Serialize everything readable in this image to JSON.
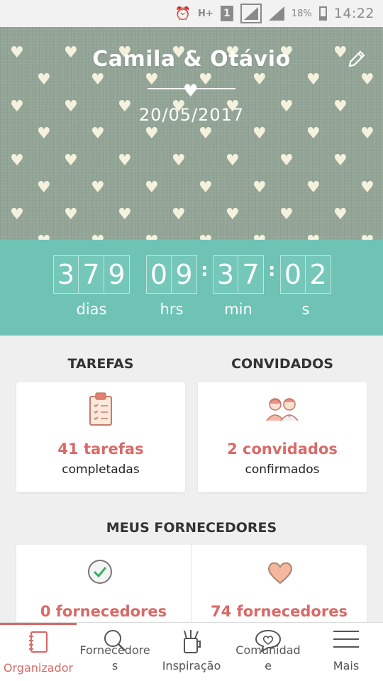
{
  "status_bar": {
    "battery_pct": "18%",
    "time": "14:22",
    "network": "H+",
    "sim": "1"
  },
  "hero": {
    "title": "Camila & Otávio",
    "date": "20/05/2017",
    "edit_icon": "pencil-icon"
  },
  "countdown": {
    "days": [
      "3",
      "7",
      "9"
    ],
    "hours": [
      "0",
      "9"
    ],
    "minutes": [
      "3",
      "7"
    ],
    "seconds": [
      "0",
      "2"
    ],
    "labels": {
      "days": "dias",
      "hours": "hrs",
      "minutes": "min",
      "seconds": "s"
    }
  },
  "tasks": {
    "title": "TAREFAS",
    "count": "41 tarefas",
    "sub": "completadas",
    "icon": "clipboard-icon"
  },
  "guests": {
    "title": "CONVIDADOS",
    "count": "2 convidados",
    "sub": "confirmados",
    "icon": "couple-icon"
  },
  "vendors": {
    "title": "MEUS FORNECEDORES",
    "left": {
      "count": "0 fornecedores",
      "icon": "checkmark-circle-icon"
    },
    "right": {
      "count": "74 fornecedores",
      "icon": "heart-icon"
    }
  },
  "nav": {
    "items": [
      {
        "label": "Organizador",
        "icon": "notebook-icon",
        "active": true
      },
      {
        "label": "Fornecedores",
        "icon": "search-icon",
        "active": false
      },
      {
        "label": "Inspiração",
        "icon": "pencil-cup-icon",
        "active": false
      },
      {
        "label": "Comunidade",
        "icon": "chat-heart-icon",
        "active": false
      },
      {
        "label": "Mais",
        "icon": "menu-icon",
        "active": false
      }
    ],
    "label_line1": {
      "fornecedores": "Fornecedore",
      "comunidade": "Comunidad"
    },
    "label_line2": {
      "fornecedores": "s",
      "comunidade": "e"
    }
  },
  "colors": {
    "accent": "#d86a67",
    "teal": "#6fc3b5",
    "hero_bg": "#93a597"
  }
}
